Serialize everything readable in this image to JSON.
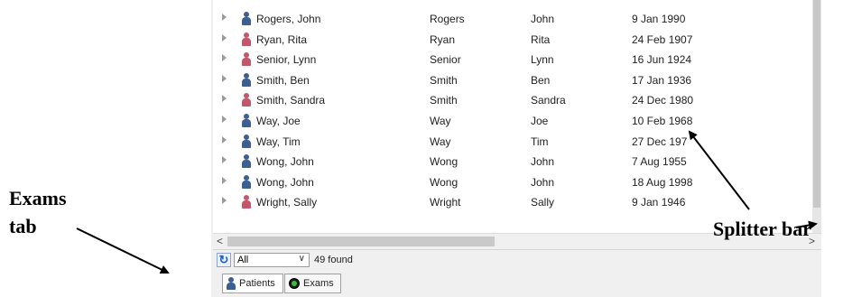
{
  "patients": [
    {
      "name": "Rogers, John",
      "last": "Rogers",
      "first": "John",
      "dob": "9 Jan 1990",
      "gender": "male"
    },
    {
      "name": "Ryan, Rita",
      "last": "Ryan",
      "first": "Rita",
      "dob": "24 Feb 1907",
      "gender": "female"
    },
    {
      "name": "Senior, Lynn",
      "last": "Senior",
      "first": "Lynn",
      "dob": "16 Jun 1924",
      "gender": "female"
    },
    {
      "name": "Smith, Ben",
      "last": "Smith",
      "first": "Ben",
      "dob": "17 Jan 1936",
      "gender": "male"
    },
    {
      "name": "Smith, Sandra",
      "last": "Smith",
      "first": "Sandra",
      "dob": "24 Dec 1980",
      "gender": "female"
    },
    {
      "name": "Way, Joe",
      "last": "Way",
      "first": "Joe",
      "dob": "10 Feb 1968",
      "gender": "male"
    },
    {
      "name": "Way, Tim",
      "last": "Way",
      "first": "Tim",
      "dob": "27 Dec 197",
      "gender": "male"
    },
    {
      "name": "Wong, John",
      "last": "Wong",
      "first": "John",
      "dob": "7 Aug 1955",
      "gender": "male"
    },
    {
      "name": "Wong, John",
      "last": "Wong",
      "first": "John",
      "dob": "18 Aug 1998",
      "gender": "male"
    },
    {
      "name": "Wright, Sally",
      "last": "Wright",
      "first": "Sally",
      "dob": "9 Jan 1946",
      "gender": "female"
    }
  ],
  "scroll": {
    "left_arrow": "<",
    "right_arrow": ">"
  },
  "status": {
    "refresh_icon": "refresh-icon",
    "filter_value": "All",
    "filter_arrow": "∨",
    "found_text": "49 found"
  },
  "tabs": {
    "patients": "Patients",
    "exams": "Exams"
  },
  "annotations": {
    "exams_line1": "Exams",
    "exams_line2": "tab",
    "splitter": "Splitter bar"
  },
  "colors": {
    "male": "#3d5e93",
    "female": "#c2566a",
    "refresh": "#1f5fbf",
    "exams_icon": "#3bbf3b"
  }
}
